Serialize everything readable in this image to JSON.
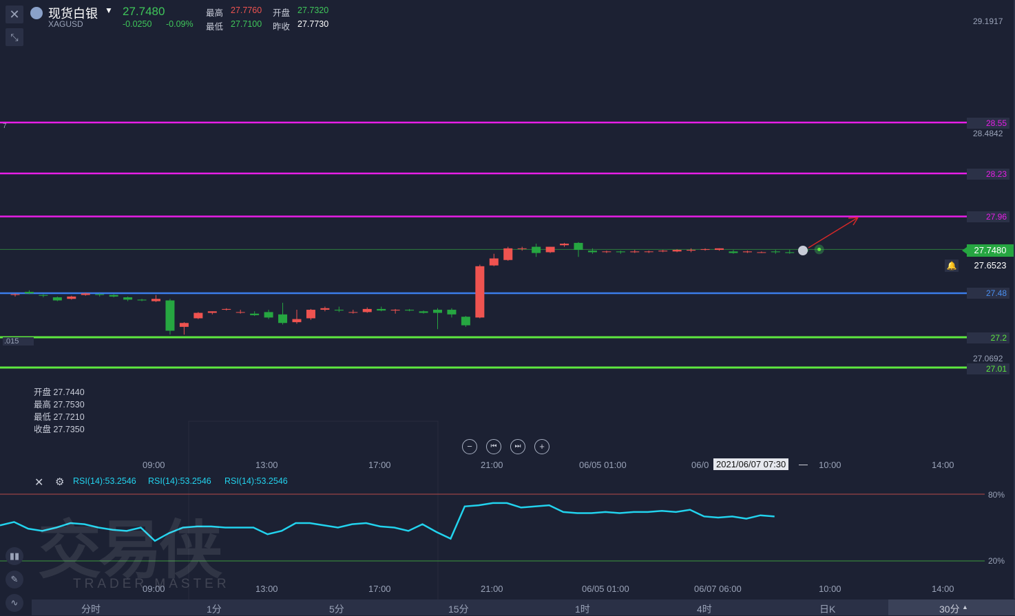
{
  "header": {
    "symbol_name": "现货白银",
    "symbol_code": "XAGUSD",
    "price": "27.7480",
    "change": "-0.0250",
    "change_pct": "-0.09%",
    "high_label": "最高",
    "high": "27.7760",
    "open_label": "开盘",
    "open": "27.7320",
    "low_label": "最低",
    "low": "27.7100",
    "prev_close_label": "昨收",
    "prev_close": "27.7730"
  },
  "hover": {
    "open": "开盘 27.7440",
    "high": "最高 27.7530",
    "low": "最低 27.7210",
    "close": "收盘 27.7350"
  },
  "price_axis": {
    "top": "29.1917",
    "mid": "28.4842",
    "low": "27.0692",
    "current": "27.7480",
    "alert": "27.6523",
    "left_stub_top": "7",
    "left_stub_bottom": ".015"
  },
  "levels": [
    {
      "label": "28.55",
      "color": "#e81ee8"
    },
    {
      "label": "28.23",
      "color": "#e81ee8"
    },
    {
      "label": "27.96",
      "color": "#e81ee8"
    },
    {
      "label": "27.48",
      "color": "#3b7dea"
    },
    {
      "label": "27.2",
      "color": "#5ee83f"
    },
    {
      "label": "27.01",
      "color": "#5ee83f"
    }
  ],
  "time_axis": [
    "09:00",
    "13:00",
    "17:00",
    "21:00",
    "06/05 01:00",
    "06/0",
    "10:00",
    "14:00"
  ],
  "crosshair_time": "2021/06/07 07:30",
  "rsi": {
    "labels": [
      "RSI(14):53.2546",
      "RSI(14):53.2546",
      "RSI(14):53.2546"
    ],
    "upper": "80%",
    "lower": "20%",
    "time_axis": [
      "09:00",
      "13:00",
      "17:00",
      "21:00",
      "06/05 01:00",
      "06/07 06:00",
      "10:00",
      "14:00"
    ]
  },
  "timeframes": [
    "分时",
    "1分",
    "5分",
    "15分",
    "1时",
    "4时",
    "日K",
    "30分"
  ],
  "watermark": {
    "cn": "交易侠",
    "en": "TRADER MASTER"
  },
  "colors": {
    "up": "#ef5350",
    "down": "#26a641",
    "rsi": "#22d3ee",
    "background": "#1c2133"
  },
  "chart_data": {
    "type": "candlestick",
    "title": "现货白银 XAGUSD",
    "interval": "30分",
    "ylim": [
      26.9,
      29.25
    ],
    "candles": [
      {
        "o": 27.455,
        "h": 27.465,
        "l": 27.445,
        "c": 27.46
      },
      {
        "o": 27.475,
        "h": 27.485,
        "l": 27.46,
        "c": 27.465
      },
      {
        "o": 27.455,
        "h": 27.46,
        "l": 27.44,
        "c": 27.45
      },
      {
        "o": 27.44,
        "h": 27.445,
        "l": 27.415,
        "c": 27.42
      },
      {
        "o": 27.43,
        "h": 27.45,
        "l": 27.425,
        "c": 27.445
      },
      {
        "o": 27.455,
        "h": 27.47,
        "l": 27.45,
        "c": 27.465
      },
      {
        "o": 27.46,
        "h": 27.465,
        "l": 27.445,
        "c": 27.455
      },
      {
        "o": 27.455,
        "h": 27.46,
        "l": 27.44,
        "c": 27.445
      },
      {
        "o": 27.44,
        "h": 27.445,
        "l": 27.415,
        "c": 27.425
      },
      {
        "o": 27.425,
        "h": 27.43,
        "l": 27.415,
        "c": 27.42
      },
      {
        "o": 27.415,
        "h": 27.455,
        "l": 27.41,
        "c": 27.43
      },
      {
        "o": 27.42,
        "h": 27.43,
        "l": 27.2,
        "c": 27.225
      },
      {
        "o": 27.25,
        "h": 27.28,
        "l": 27.2,
        "c": 27.275
      },
      {
        "o": 27.305,
        "h": 27.345,
        "l": 27.3,
        "c": 27.34
      },
      {
        "o": 27.34,
        "h": 27.35,
        "l": 27.33,
        "c": 27.35
      },
      {
        "o": 27.36,
        "h": 27.37,
        "l": 27.355,
        "c": 27.365
      },
      {
        "o": 27.345,
        "h": 27.36,
        "l": 27.335,
        "c": 27.345
      },
      {
        "o": 27.335,
        "h": 27.35,
        "l": 27.32,
        "c": 27.325
      },
      {
        "o": 27.345,
        "h": 27.36,
        "l": 27.3,
        "c": 27.31
      },
      {
        "o": 27.33,
        "h": 27.405,
        "l": 27.265,
        "c": 27.275
      },
      {
        "o": 27.28,
        "h": 27.36,
        "l": 27.27,
        "c": 27.3
      },
      {
        "o": 27.305,
        "h": 27.365,
        "l": 27.295,
        "c": 27.36
      },
      {
        "o": 27.36,
        "h": 27.38,
        "l": 27.35,
        "c": 27.37
      },
      {
        "o": 27.36,
        "h": 27.38,
        "l": 27.345,
        "c": 27.355
      },
      {
        "o": 27.345,
        "h": 27.36,
        "l": 27.335,
        "c": 27.345
      },
      {
        "o": 27.345,
        "h": 27.375,
        "l": 27.34,
        "c": 27.365
      },
      {
        "o": 27.365,
        "h": 27.38,
        "l": 27.35,
        "c": 27.355
      },
      {
        "o": 27.355,
        "h": 27.365,
        "l": 27.335,
        "c": 27.36
      },
      {
        "o": 27.36,
        "h": 27.365,
        "l": 27.35,
        "c": 27.355
      },
      {
        "o": 27.35,
        "h": 27.355,
        "l": 27.335,
        "c": 27.34
      },
      {
        "o": 27.36,
        "h": 27.37,
        "l": 27.235,
        "c": 27.34
      },
      {
        "o": 27.36,
        "h": 27.37,
        "l": 27.31,
        "c": 27.33
      },
      {
        "o": 27.315,
        "h": 27.32,
        "l": 27.25,
        "c": 27.26
      },
      {
        "o": 27.31,
        "h": 27.65,
        "l": 27.305,
        "c": 27.64
      },
      {
        "o": 27.645,
        "h": 27.72,
        "l": 27.64,
        "c": 27.69
      },
      {
        "o": 27.68,
        "h": 27.765,
        "l": 27.675,
        "c": 27.755
      },
      {
        "o": 27.755,
        "h": 27.765,
        "l": 27.74,
        "c": 27.755
      },
      {
        "o": 27.765,
        "h": 27.785,
        "l": 27.7,
        "c": 27.725
      },
      {
        "o": 27.73,
        "h": 27.765,
        "l": 27.725,
        "c": 27.765
      },
      {
        "o": 27.775,
        "h": 27.79,
        "l": 27.765,
        "c": 27.785
      },
      {
        "o": 27.79,
        "h": 27.795,
        "l": 27.7,
        "c": 27.745
      },
      {
        "o": 27.74,
        "h": 27.755,
        "l": 27.72,
        "c": 27.73
      },
      {
        "o": 27.735,
        "h": 27.74,
        "l": 27.725,
        "c": 27.735
      },
      {
        "o": 27.735,
        "h": 27.74,
        "l": 27.72,
        "c": 27.73
      },
      {
        "o": 27.73,
        "h": 27.745,
        "l": 27.725,
        "c": 27.735
      },
      {
        "o": 27.735,
        "h": 27.74,
        "l": 27.725,
        "c": 27.735
      },
      {
        "o": 27.735,
        "h": 27.745,
        "l": 27.73,
        "c": 27.74
      },
      {
        "o": 27.735,
        "h": 27.75,
        "l": 27.73,
        "c": 27.745
      },
      {
        "o": 27.74,
        "h": 27.755,
        "l": 27.73,
        "c": 27.745
      },
      {
        "o": 27.745,
        "h": 27.755,
        "l": 27.74,
        "c": 27.75
      },
      {
        "o": 27.745,
        "h": 27.755,
        "l": 27.74,
        "c": 27.755
      },
      {
        "o": 27.735,
        "h": 27.745,
        "l": 27.72,
        "c": 27.725
      },
      {
        "o": 27.73,
        "h": 27.74,
        "l": 27.725,
        "c": 27.735
      },
      {
        "o": 27.73,
        "h": 27.735,
        "l": 27.725,
        "c": 27.73
      },
      {
        "o": 27.735,
        "h": 27.745,
        "l": 27.72,
        "c": 27.73
      },
      {
        "o": 27.73,
        "h": 27.745,
        "l": 27.72,
        "c": 27.725
      },
      {
        "o": 27.744,
        "h": 27.753,
        "l": 27.721,
        "c": 27.735
      }
    ],
    "rsi_values": [
      52,
      55,
      49,
      47,
      50,
      54,
      53,
      50,
      48,
      47,
      50,
      38,
      45,
      50,
      51,
      51,
      50,
      50,
      50,
      44,
      47,
      54,
      54,
      52,
      50,
      53,
      54,
      51,
      50,
      47,
      53,
      46,
      40,
      69,
      70,
      72,
      72,
      68,
      69,
      70,
      64,
      63,
      63,
      64,
      63,
      64,
      64,
      65,
      64,
      66,
      60,
      59,
      60,
      58,
      61,
      60
    ]
  }
}
